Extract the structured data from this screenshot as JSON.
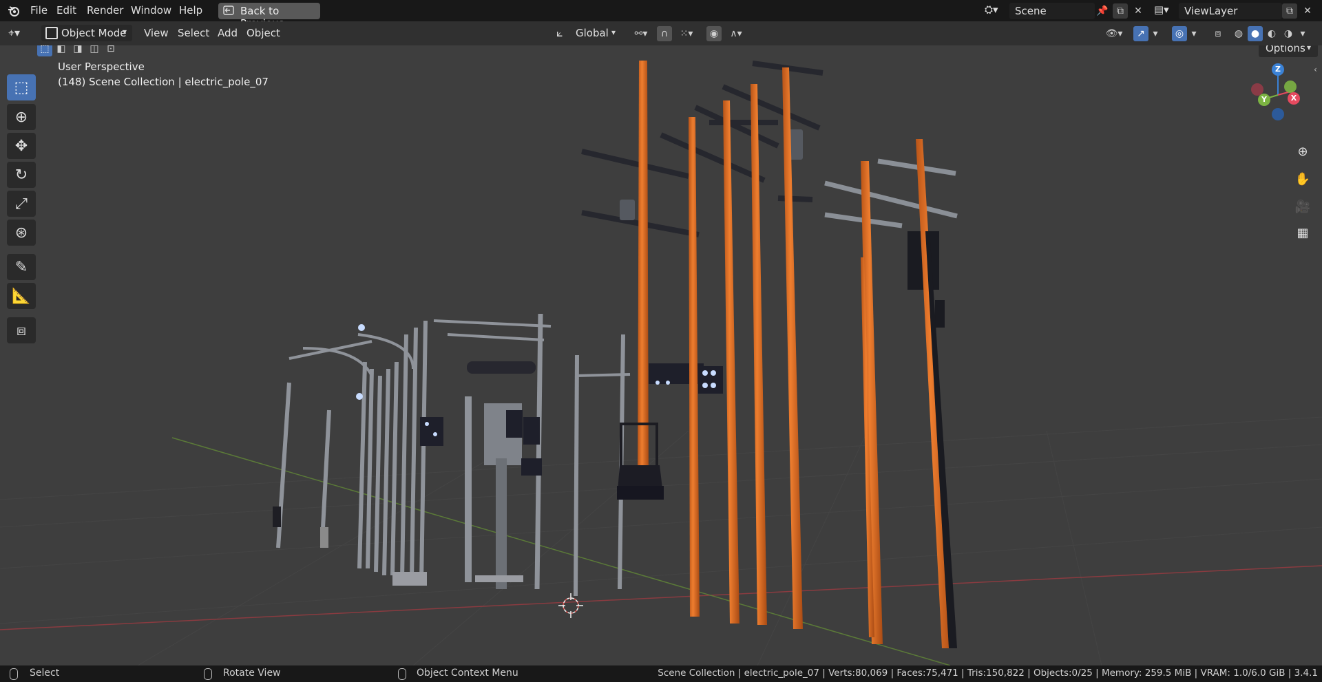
{
  "topbar": {
    "menus": [
      "File",
      "Edit",
      "Render",
      "Window",
      "Help"
    ],
    "back_button": "Back to Previous",
    "scene_name": "Scene",
    "view_layer": "ViewLayer"
  },
  "viewport_header": {
    "mode": "Object Mode",
    "menus": [
      "View",
      "Select",
      "Add",
      "Object"
    ],
    "transform_orientation": "Global",
    "options": "Options"
  },
  "overlay_text": {
    "perspective": "User Perspective",
    "collection_info": "(148) Scene Collection | electric_pole_07"
  },
  "gizmo": {
    "z": "Z",
    "y": "Y",
    "x": "X"
  },
  "statusbar": {
    "select": "Select",
    "rotate": "Rotate View",
    "context": "Object Context Menu",
    "stats": "Scene Collection | electric_pole_07 | Verts:80,069 | Faces:75,471 | Tris:150,822 | Objects:0/25 | Memory: 259.5 MiB | VRAM: 1.0/6.0 GiB | 3.4.1"
  },
  "colors": {
    "accent": "#4772b3",
    "pole_orange": "#e0712a",
    "axis_x": "#e64a5f",
    "axis_y": "#7cb342",
    "axis_z": "#3b82d6"
  }
}
